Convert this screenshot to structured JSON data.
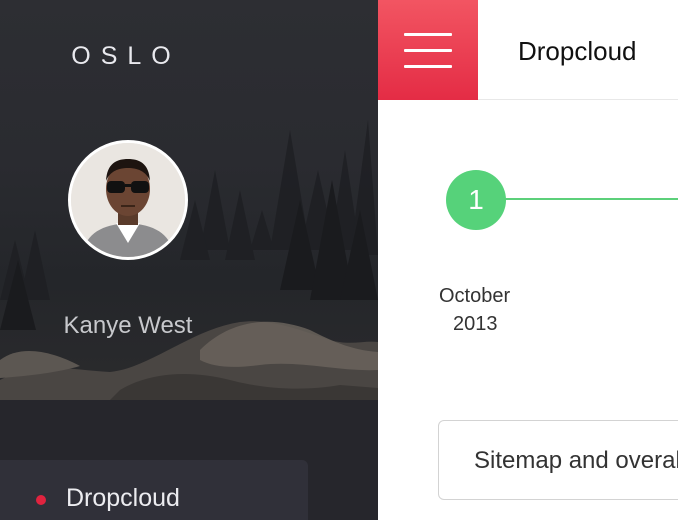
{
  "sidebar": {
    "brand": "OSLO",
    "user": {
      "name": "Kanye West"
    },
    "nav": [
      {
        "label": "Dropcloud",
        "active": true
      }
    ]
  },
  "header": {
    "menu_icon": "hamburger-icon",
    "title": "Dropcloud"
  },
  "timeline": {
    "step_number": "1",
    "month": "October",
    "year": "2013"
  },
  "card": {
    "text": "Sitemap and overal"
  },
  "colors": {
    "accent": "#e42c45",
    "step_green": "#56d27a",
    "sidebar_bg": "#26262c",
    "nav_active_bg": "#303039"
  }
}
